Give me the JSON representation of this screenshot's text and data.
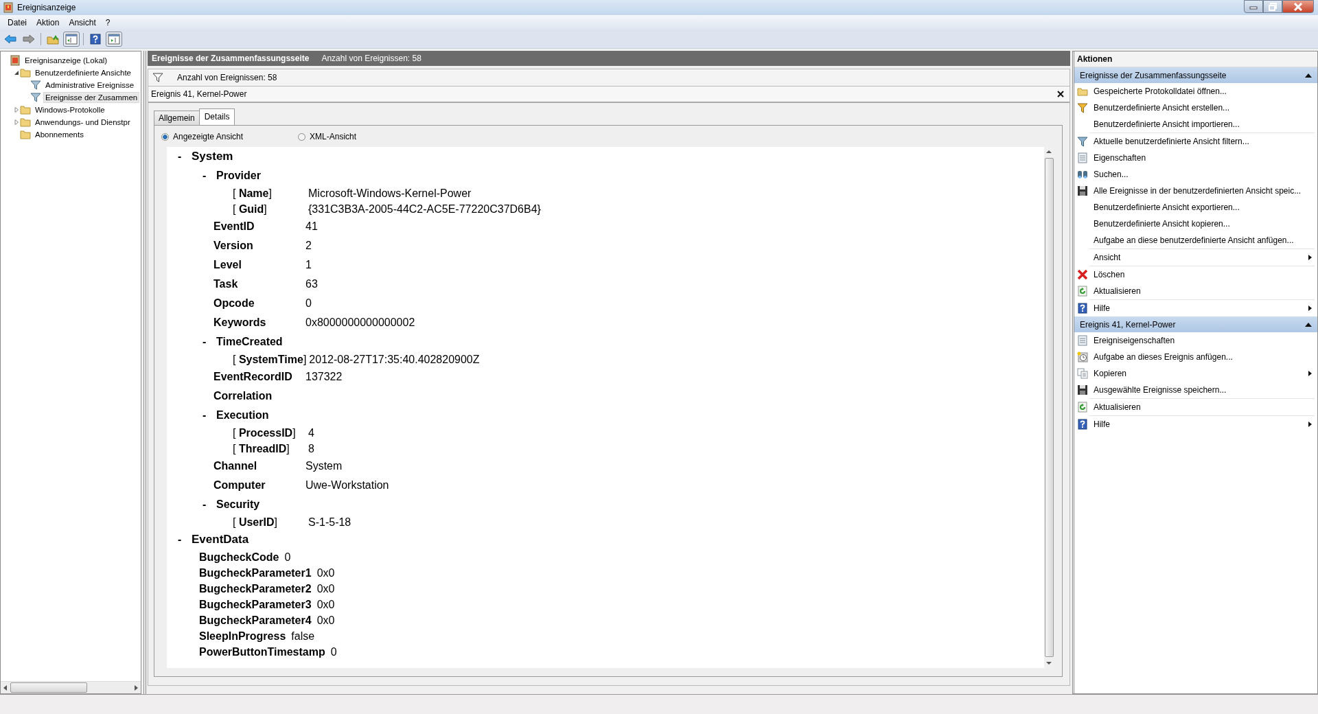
{
  "window": {
    "title": "Ereignisanzeige"
  },
  "menu": [
    "Datei",
    "Aktion",
    "Ansicht",
    "?"
  ],
  "tree": [
    {
      "label": "Ereignisanzeige (Lokal)",
      "selected": false,
      "children": [
        {
          "label": "Benutzerdefinierte Ansichte",
          "selected": false,
          "expanded": true,
          "children": [
            {
              "label": "Administrative Ereignisse",
              "selected": false
            },
            {
              "label": "Ereignisse der Zusammen",
              "selected": true
            }
          ]
        },
        {
          "label": "Windows-Protokolle",
          "selected": false,
          "expanded": false
        },
        {
          "label": "Anwendungs- und Dienstpr",
          "selected": false,
          "expanded": false
        },
        {
          "label": "Abonnements",
          "selected": false
        }
      ]
    }
  ],
  "header": {
    "title": "Ereignisse der Zusammenfassungsseite",
    "count": "Anzahl von Ereignissen: 58"
  },
  "filter_bar": {
    "text": "Anzahl von Ereignissen: 58"
  },
  "event": {
    "title": "Ereignis 41, Kernel-Power",
    "tabs": [
      {
        "label": "Allgemein",
        "selected": false
      },
      {
        "label": "Details",
        "selected": true
      }
    ],
    "views": [
      {
        "label": "Angezeigte Ansicht",
        "selected": true
      },
      {
        "label": "XML-Ansicht",
        "selected": false
      }
    ],
    "details": [
      {
        "kind": "group",
        "toggle": "-",
        "label": "System",
        "children": [
          {
            "kind": "group",
            "toggle": "-",
            "label": "Provider",
            "children": [
              {
                "kind": "attr",
                "label": "[ **Name**]",
                "value": "Microsoft-Windows-Kernel-Power"
              },
              {
                "kind": "attr",
                "label": "[ **Guid**]",
                "value": "{331C3B3A-2005-44C2-AC5E-77220C37D6B4}"
              }
            ]
          },
          {
            "kind": "field",
            "label": "EventID",
            "value": "41"
          },
          {
            "kind": "field",
            "label": "Version",
            "value": "2"
          },
          {
            "kind": "field",
            "label": "Level",
            "value": "1"
          },
          {
            "kind": "field",
            "label": "Task",
            "value": "63"
          },
          {
            "kind": "field",
            "label": "Opcode",
            "value": "0"
          },
          {
            "kind": "field",
            "label": "Keywords",
            "value": "0x8000000000000002"
          },
          {
            "kind": "group",
            "toggle": "-",
            "label": "TimeCreated",
            "children": [
              {
                "kind": "attr",
                "label": "[ **SystemTime**]",
                "value": "2012-08-27T17:35:40.402820900Z"
              }
            ]
          },
          {
            "kind": "field",
            "label": "EventRecordID",
            "value": "137322"
          },
          {
            "kind": "field",
            "label": "Correlation"
          },
          {
            "kind": "group",
            "toggle": "-",
            "label": "Execution",
            "children": [
              {
                "kind": "attr",
                "label": "[ **ProcessID**]",
                "value": "4"
              },
              {
                "kind": "attr",
                "label": "[ **ThreadID**]",
                "value": "8"
              }
            ]
          },
          {
            "kind": "field",
            "label": "Channel",
            "value": "System"
          },
          {
            "kind": "field",
            "label": "Computer",
            "value": "Uwe-Workstation"
          },
          {
            "kind": "group",
            "toggle": "-",
            "label": "Security",
            "children": [
              {
                "kind": "attr",
                "label": "[ **UserID**]",
                "value": "S-1-5-18"
              }
            ]
          }
        ]
      },
      {
        "kind": "group",
        "toggle": "-",
        "label": "EventData",
        "children": [
          {
            "kind": "data",
            "label": "BugcheckCode",
            "value": "0"
          },
          {
            "kind": "data",
            "label": "BugcheckParameter1",
            "value": "0x0"
          },
          {
            "kind": "data",
            "label": "BugcheckParameter2",
            "value": "0x0"
          },
          {
            "kind": "data",
            "label": "BugcheckParameter3",
            "value": "0x0"
          },
          {
            "kind": "data",
            "label": "BugcheckParameter4",
            "value": "0x0"
          },
          {
            "kind": "data",
            "label": "SleepInProgress",
            "value": "false"
          },
          {
            "kind": "data",
            "label": "PowerButtonTimestamp",
            "value": "0"
          }
        ]
      }
    ]
  },
  "actions": {
    "title": "Aktionen",
    "sections": [
      {
        "title": "Ereignisse der Zusammenfassungsseite",
        "expanded": true,
        "items": [
          {
            "label": "Gespeicherte Protokolldatei öffnen..."
          },
          {
            "label": "Benutzerdefinierte Ansicht erstellen..."
          },
          {
            "label": "Benutzerdefinierte Ansicht importieren...",
            "separator_after": true
          },
          {
            "label": "Aktuelle benutzerdefinierte Ansicht filtern..."
          },
          {
            "label": "Eigenschaften"
          },
          {
            "label": "Suchen..."
          },
          {
            "label": "Alle Ereignisse in der benutzerdefinierten Ansicht speic..."
          },
          {
            "label": "Benutzerdefinierte Ansicht exportieren..."
          },
          {
            "label": "Benutzerdefinierte Ansicht kopieren..."
          },
          {
            "label": "Aufgabe an diese benutzerdefinierte Ansicht anfügen...",
            "separator_after": true
          },
          {
            "label": "Ansicht",
            "submenu": true,
            "separator_after": true
          },
          {
            "label": "Löschen"
          },
          {
            "label": "Aktualisieren",
            "separator_after": true
          },
          {
            "label": "Hilfe",
            "submenu": true
          }
        ]
      },
      {
        "title": "Ereignis 41, Kernel-Power",
        "expanded": true,
        "items": [
          {
            "label": "Ereigniseigenschaften"
          },
          {
            "label": "Aufgabe an dieses Ereignis anfügen..."
          },
          {
            "label": "Kopieren",
            "submenu": true
          },
          {
            "label": "Ausgewählte Ereignisse speichern...",
            "separator_after": true
          },
          {
            "label": "Aktualisieren",
            "separator_after": true
          },
          {
            "label": "Hilfe",
            "submenu": true
          }
        ]
      }
    ]
  }
}
